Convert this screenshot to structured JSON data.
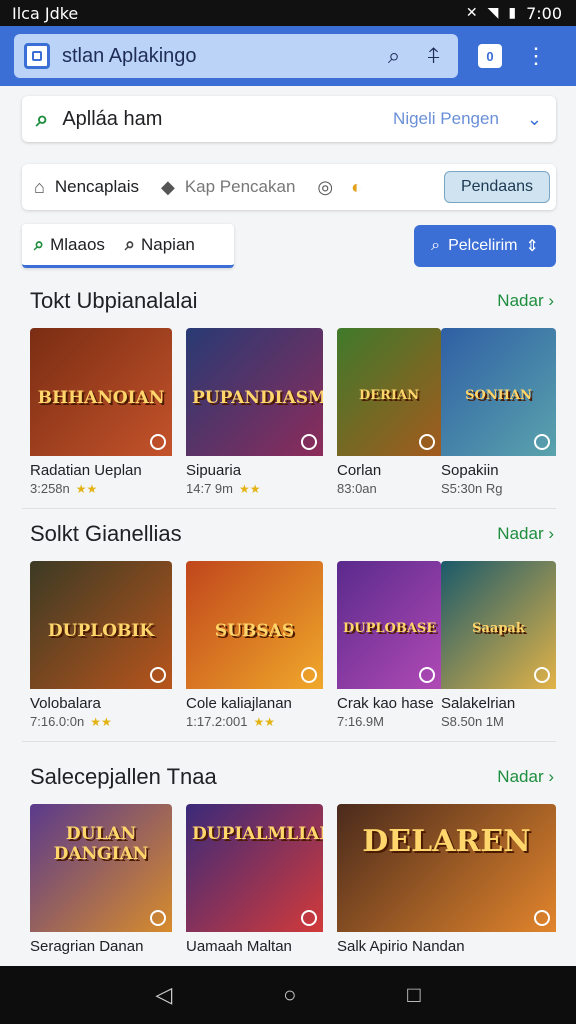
{
  "status": {
    "carrier": "Ilca Jdke",
    "time": "7:00"
  },
  "app_bar": {
    "url": "stlan Aplakingo"
  },
  "search": {
    "value": "Aplláa ham",
    "hint": "Nigeli Pengen"
  },
  "categories": [
    {
      "icon": "home-icon",
      "label": "Nencaplais"
    },
    {
      "icon": "tag-icon",
      "label": "Kap Pencakan"
    }
  ],
  "category_pill": "Pendaans",
  "filters": {
    "chip1": "Mlaaos",
    "chip2": "Napian",
    "action": "Pelcelirim"
  },
  "sections": [
    {
      "title": "Tokt Ubpianalalai",
      "more": "Nadar",
      "items": [
        {
          "name": "Radatian Ueplan",
          "meta": "3:258n",
          "art": "BHHANOIAN",
          "colors": [
            "#7a2d13",
            "#c4532b"
          ]
        },
        {
          "name": "Sipuaria",
          "meta": "14:7 9m",
          "art": "PUPANDIASM",
          "colors": [
            "#283a74",
            "#8c2c5a"
          ]
        },
        {
          "name": "Corlan",
          "meta": "83:0an",
          "art": "DERIAN",
          "colors": [
            "#3f7a2b",
            "#a35a1e"
          ]
        },
        {
          "name": "Sopakiin",
          "meta": "S5:30n Rg",
          "art": "SONHAN",
          "colors": [
            "#2f5fa4",
            "#5aa3ad"
          ]
        }
      ]
    },
    {
      "title": "Solkt Gianellias",
      "more": "Nadar",
      "items": [
        {
          "name": "Volobalara",
          "meta": "7:16.0:0n",
          "art": "DUPLOBIK",
          "colors": [
            "#3c3a24",
            "#b8551c"
          ]
        },
        {
          "name": "Cole kaliajlanan",
          "meta": "1:17.2:001",
          "art": "SUBSAS",
          "colors": [
            "#c0461c",
            "#f0a82a"
          ]
        },
        {
          "name": "Crak kao hase",
          "meta": "7:16.9M",
          "art": "DUPLOBASE",
          "colors": [
            "#5a2a8c",
            "#b04ab5"
          ]
        },
        {
          "name": "Salakelrian",
          "meta": "S8.50n 1M",
          "art": "Saapak",
          "colors": [
            "#1a5a6a",
            "#e2b348"
          ]
        }
      ]
    },
    {
      "title": "Salecepjallen Tnaa",
      "more": "Nadar",
      "items": [
        {
          "name": "Seragrian Danan",
          "meta": "",
          "art": "DULAN DANGIAN",
          "colors": [
            "#5a3a8c",
            "#d78c2c"
          ]
        },
        {
          "name": "Uamaah Maltan",
          "meta": "",
          "art": "DUPIALMLIAN",
          "colors": [
            "#3a2a7a",
            "#d23a3a"
          ]
        },
        {
          "name": "Salk Apirio Nandan",
          "meta": "",
          "art": "DELAREN",
          "colors": [
            "#4a2a1c",
            "#e2852c"
          ]
        }
      ]
    }
  ]
}
